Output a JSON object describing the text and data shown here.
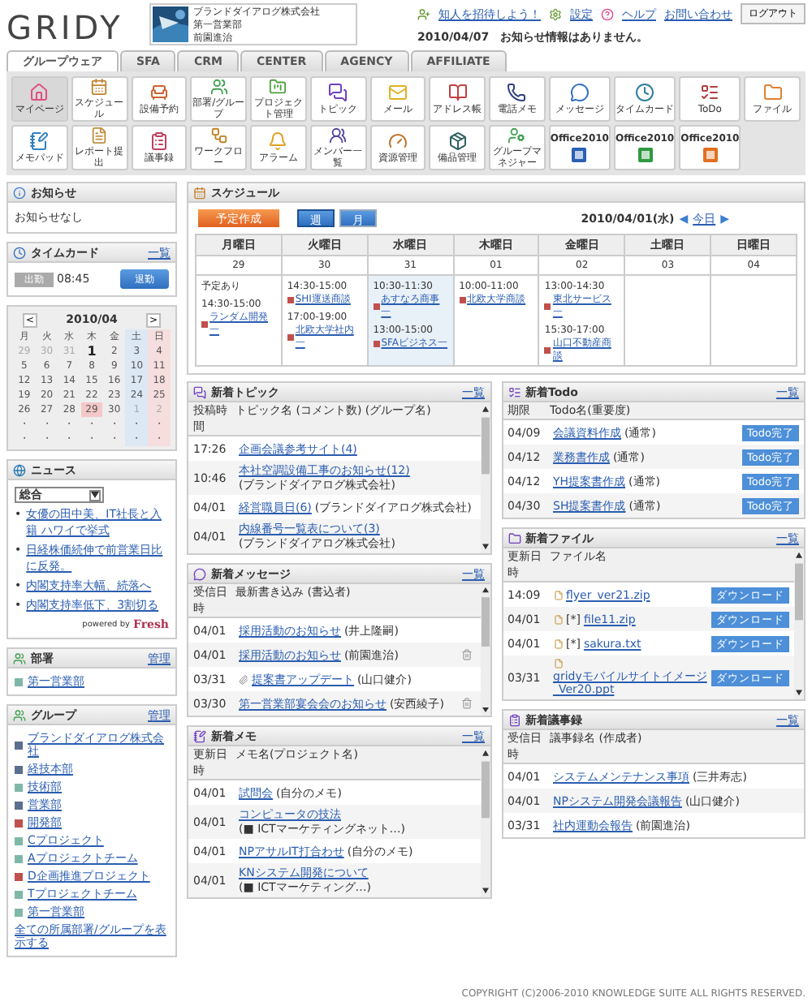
{
  "header": {
    "logo": "GRIDY",
    "company": [
      "ブランドダイアログ株式会社",
      "第一営業部",
      "前園進治"
    ],
    "links": [
      {
        "label": "知人を招待しよう！"
      },
      {
        "label": "設定"
      },
      {
        "label": "ヘルプ"
      },
      {
        "label": "お問い合わせ"
      }
    ],
    "logout": "ログアウト",
    "notice": "2010/04/07　お知らせ情報はありません。"
  },
  "tabs": [
    {
      "label": "グループウェア",
      "selected": true
    },
    {
      "label": "SFA",
      "selected": false
    },
    {
      "label": "CRM",
      "selected": false
    },
    {
      "label": "CENTER",
      "selected": false
    },
    {
      "label": "AGENCY",
      "selected": false
    },
    {
      "label": "AFFILIATE",
      "selected": false
    }
  ],
  "apps": [
    {
      "kind": "app",
      "label": "マイページ",
      "selected": true
    },
    {
      "kind": "app",
      "label": "スケジュール",
      "selected": false
    },
    {
      "kind": "app",
      "label": "設備予約",
      "selected": false
    },
    {
      "kind": "app",
      "label": "部署/グループ",
      "selected": false
    },
    {
      "kind": "app",
      "label": "プロジェクト管理",
      "selected": false
    },
    {
      "kind": "app",
      "label": "トピック",
      "selected": false
    },
    {
      "kind": "app",
      "label": "メール",
      "selected": false
    },
    {
      "kind": "app",
      "label": "アドレス帳",
      "selected": false
    },
    {
      "kind": "app",
      "label": "電話メモ",
      "selected": false
    },
    {
      "kind": "app",
      "label": "メッセージ",
      "selected": false
    },
    {
      "kind": "app",
      "label": "タイムカード",
      "selected": false
    },
    {
      "kind": "app",
      "label": "ToDo",
      "selected": false
    },
    {
      "kind": "app",
      "label": "ファイル",
      "selected": false
    },
    {
      "kind": "app",
      "label": "メモパッド",
      "selected": false
    },
    {
      "kind": "app",
      "label": "レポート提出",
      "selected": false
    },
    {
      "kind": "app",
      "label": "議事録",
      "selected": false
    },
    {
      "kind": "app",
      "label": "ワークフロー",
      "selected": false
    },
    {
      "kind": "app",
      "label": "アラーム",
      "selected": false
    },
    {
      "kind": "app",
      "label": "メンバー一覧",
      "selected": false
    },
    {
      "kind": "app",
      "label": "資源管理",
      "selected": false
    },
    {
      "kind": "app",
      "label": "備品管理",
      "selected": false
    },
    {
      "kind": "app",
      "label": "グループマネジャー",
      "selected": false
    },
    {
      "kind": "office",
      "label": "Office2010",
      "selected": false
    },
    {
      "kind": "office",
      "label": "Office2010",
      "selected": false
    },
    {
      "kind": "office",
      "label": "Office2010",
      "selected": false
    }
  ],
  "notice_box": {
    "title": "お知らせ",
    "text": "お知らせなし"
  },
  "timecard": {
    "title": "タイムカード",
    "link": "一覧",
    "clock_in": {
      "label": "出勤",
      "disabled": true
    },
    "time": "08:45",
    "clock_out": {
      "label": "退勤",
      "disabled": false
    }
  },
  "calendar": {
    "prev": "<",
    "month": "2010/04",
    "next": ">",
    "weekdays": [
      "月",
      "火",
      "水",
      "木",
      "金",
      "土",
      "日"
    ],
    "weeks": [
      [
        {
          "day": "29",
          "muted": true,
          "selected": false,
          "holiday": false
        },
        {
          "day": "30",
          "muted": true,
          "selected": false,
          "holiday": false
        },
        {
          "day": "31",
          "muted": true,
          "selected": false,
          "holiday": false
        },
        {
          "day": "1",
          "muted": false,
          "selected": true,
          "holiday": false
        },
        {
          "day": "2",
          "muted": false,
          "selected": false,
          "holiday": false
        },
        {
          "day": "3",
          "muted": false,
          "selected": false,
          "holiday": false
        },
        {
          "day": "4",
          "muted": false,
          "selected": false,
          "holiday": false
        }
      ],
      [
        {
          "day": "5",
          "muted": false,
          "selected": false,
          "holiday": false
        },
        {
          "day": "6",
          "muted": false,
          "selected": false,
          "holiday": false
        },
        {
          "day": "7",
          "muted": false,
          "selected": false,
          "holiday": false
        },
        {
          "day": "8",
          "muted": false,
          "selected": false,
          "holiday": false
        },
        {
          "day": "9",
          "muted": false,
          "selected": false,
          "holiday": false
        },
        {
          "day": "10",
          "muted": false,
          "selected": false,
          "holiday": false
        },
        {
          "day": "11",
          "muted": false,
          "selected": false,
          "holiday": false
        }
      ],
      [
        {
          "day": "12",
          "muted": false,
          "selected": false,
          "holiday": false
        },
        {
          "day": "13",
          "muted": false,
          "selected": false,
          "holiday": false
        },
        {
          "day": "14",
          "muted": false,
          "selected": false,
          "holiday": false
        },
        {
          "day": "15",
          "muted": false,
          "selected": false,
          "holiday": false
        },
        {
          "day": "16",
          "muted": false,
          "selected": false,
          "holiday": false
        },
        {
          "day": "17",
          "muted": false,
          "selected": false,
          "holiday": false
        },
        {
          "day": "18",
          "muted": false,
          "selected": false,
          "holiday": false
        }
      ],
      [
        {
          "day": "19",
          "muted": false,
          "selected": false,
          "holiday": false
        },
        {
          "day": "20",
          "muted": false,
          "selected": false,
          "holiday": false
        },
        {
          "day": "21",
          "muted": false,
          "selected": false,
          "holiday": false
        },
        {
          "day": "22",
          "muted": false,
          "selected": false,
          "holiday": false
        },
        {
          "day": "23",
          "muted": false,
          "selected": false,
          "holiday": false
        },
        {
          "day": "24",
          "muted": false,
          "selected": false,
          "holiday": false
        },
        {
          "day": "25",
          "muted": false,
          "selected": false,
          "holiday": false
        }
      ],
      [
        {
          "day": "26",
          "muted": false,
          "selected": false,
          "holiday": false
        },
        {
          "day": "27",
          "muted": false,
          "selected": false,
          "holiday": false
        },
        {
          "day": "28",
          "muted": false,
          "selected": false,
          "holiday": false
        },
        {
          "day": "29",
          "muted": false,
          "selected": false,
          "holiday": true
        },
        {
          "day": "30",
          "muted": false,
          "selected": false,
          "holiday": false
        },
        {
          "day": "1",
          "muted": true,
          "selected": false,
          "holiday": false
        },
        {
          "day": "2",
          "muted": true,
          "selected": false,
          "holiday": false
        }
      ],
      [
        {
          "day": "・",
          "muted": false,
          "selected": false,
          "holiday": false
        },
        {
          "day": "・",
          "muted": false,
          "selected": false,
          "holiday": false
        },
        {
          "day": "・",
          "muted": false,
          "selected": false,
          "holiday": false
        },
        {
          "day": "・",
          "muted": false,
          "selected": false,
          "holiday": false
        },
        {
          "day": "・",
          "muted": false,
          "selected": false,
          "holiday": false
        },
        {
          "day": "・",
          "muted": false,
          "selected": false,
          "holiday": false
        },
        {
          "day": "・",
          "muted": false,
          "selected": false,
          "holiday": false
        }
      ],
      [
        {
          "day": "・",
          "muted": false,
          "selected": false,
          "holiday": false
        },
        {
          "day": "・",
          "muted": false,
          "selected": false,
          "holiday": false
        },
        {
          "day": "・",
          "muted": false,
          "selected": false,
          "holiday": false
        },
        {
          "day": "・",
          "muted": false,
          "selected": false,
          "holiday": false
        },
        {
          "day": "・",
          "muted": false,
          "selected": false,
          "holiday": false
        },
        {
          "day": "・",
          "muted": false,
          "selected": false,
          "holiday": false
        },
        {
          "day": "・",
          "muted": false,
          "selected": false,
          "holiday": false
        }
      ]
    ]
  },
  "news": {
    "title": "ニュース",
    "category": "総合",
    "marker": "•",
    "items": [
      "女優の田中美、IT社長と入籍 ハワイで挙式",
      "日経株価続伸で前営業日比に反発。",
      "内閣支持率大幅、続落へ",
      "内閣支持率低下、3割切る"
    ],
    "powered_by": "powered by",
    "brand": "Fresh"
  },
  "departments": {
    "title": "部署",
    "link": "管理",
    "items": [
      {
        "label": "第一営業部",
        "color": "#7fb8a8"
      }
    ]
  },
  "groups": {
    "title": "グループ",
    "link": "管理",
    "items": [
      {
        "label": "ブランドダイアログ株式会社",
        "color": "#5b6f8e"
      },
      {
        "label": "経技本部",
        "color": "#5b6f8e"
      },
      {
        "label": "技術部",
        "color": "#7fb8a8"
      },
      {
        "label": "営業部",
        "color": "#5b6f8e"
      },
      {
        "label": "開発部",
        "color": "#c0504d"
      },
      {
        "label": "Cプロジェクト",
        "color": "#7fb8a8"
      },
      {
        "label": "Aプロジェクトチーム",
        "color": "#7fb8a8"
      },
      {
        "label": "D企画推進プロジェクト",
        "color": "#c0504d"
      },
      {
        "label": "Tプロジェクトチーム",
        "color": "#7fb8a8"
      },
      {
        "label": "第一営業部",
        "color": "#7fb8a8"
      }
    ],
    "show_all": "全ての所属部署/グループを表示する"
  },
  "schedule": {
    "title": "スケジュール",
    "create": "予定作成",
    "views": [
      {
        "label": "週",
        "selected": true
      },
      {
        "label": "月",
        "selected": false
      }
    ],
    "date": "2010/04/01(水)",
    "prev": "◀",
    "today": "今日",
    "next": "▶",
    "days": [
      {
        "name": "月曜日",
        "date": "29",
        "today": false,
        "entries": [
          {
            "kind": "note",
            "text": "予定あり"
          },
          {
            "kind": "event",
            "time": "14:30-15:00",
            "title": "ランダム開発一"
          }
        ]
      },
      {
        "name": "火曜日",
        "date": "30",
        "today": false,
        "entries": [
          {
            "kind": "event",
            "time": "14:30-15:00",
            "title": "SHI運送商談"
          },
          {
            "kind": "event",
            "time": "17:00-19:00",
            "title": "北欧大学社内一"
          }
        ]
      },
      {
        "name": "水曜日",
        "date": "31",
        "today": true,
        "entries": [
          {
            "kind": "event",
            "time": "10:30-11:30",
            "title": "あすなろ商事一"
          },
          {
            "kind": "event",
            "time": "13:00-15:00",
            "title": "SFAビジネス一"
          }
        ]
      },
      {
        "name": "木曜日",
        "date": "01",
        "today": false,
        "entries": [
          {
            "kind": "event",
            "time": "10:00-11:00",
            "title": "北欧大学商談"
          }
        ]
      },
      {
        "name": "金曜日",
        "date": "02",
        "today": false,
        "entries": [
          {
            "kind": "event",
            "time": "13:00-14:30",
            "title": "東北サービス一"
          },
          {
            "kind": "event",
            "time": "15:30-17:00",
            "title": "山口不動産商談"
          }
        ]
      },
      {
        "name": "土曜日",
        "date": "03",
        "today": false
      },
      {
        "name": "日曜日",
        "date": "04",
        "today": false
      }
    ]
  },
  "topics": {
    "title": "新着トピック",
    "link": "一覧",
    "scrollbar": true,
    "columns": [
      "投稿時間",
      "トピック名 (コメント数) (グループ名)"
    ],
    "rows": [
      {
        "date": "17:26",
        "link": "企画会議参考サイト(4)"
      },
      {
        "date": "10:46",
        "link": "本社空調設備工事のお知らせ(12)",
        "note": "(ブランドダイアログ株式会社)"
      },
      {
        "date": "04/01",
        "link": "経営職員日(6)",
        "note": "(ブランドダイアログ株式会社)"
      },
      {
        "date": "04/01",
        "link": "内線番号一覧表について(3)",
        "note": "(ブランドダイアログ株式会社)"
      }
    ]
  },
  "messages": {
    "title": "新着メッセージ",
    "link": "一覧",
    "scrollbar": true,
    "columns": [
      "受信日時",
      "最新書き込み (書込者)"
    ],
    "rows": [
      {
        "date": "04/01",
        "link": "採用活動のお知らせ",
        "note": "(井上隆嗣)",
        "attachment": false,
        "deletable": false
      },
      {
        "date": "04/01",
        "link": "採用活動のお知らせ",
        "note": "(前園進治)",
        "attachment": false,
        "deletable": true
      },
      {
        "date": "03/31",
        "link": "提案書アップデート",
        "note": "(山口健介)",
        "attachment": true,
        "deletable": false
      },
      {
        "date": "03/30",
        "link": "第一営業部宴会会のお知らせ",
        "note": "(安西綾子)",
        "attachment": false,
        "deletable": true
      }
    ]
  },
  "memos": {
    "title": "新着メモ",
    "link": "一覧",
    "scrollbar": true,
    "columns": [
      "更新日時",
      "メモ名(プロジェクト名)"
    ],
    "rows": [
      {
        "date": "04/01",
        "link": "試問会",
        "note": "(自分のメモ)"
      },
      {
        "date": "04/01",
        "link": "コンピュータの技法",
        "note": "(■ ICTマーケティングネット…)"
      },
      {
        "date": "04/01",
        "link": "NPアサルIT打合わせ",
        "note": "(自分のメモ)"
      },
      {
        "date": "04/01",
        "link": "KNシステム開発について",
        "note": "(■ ICTマーケティング…)"
      }
    ]
  },
  "todos": {
    "title": "新着Todo",
    "link": "一覧",
    "scrollbar": false,
    "columns": [
      "期限",
      "Todo名(重要度)"
    ],
    "rows": [
      {
        "date": "04/09",
        "link": "会議資料作成",
        "note": "(通常)",
        "button": "Todo完了"
      },
      {
        "date": "04/12",
        "link": "業務書作成",
        "note": "(通常)",
        "button": "Todo完了"
      },
      {
        "date": "04/12",
        "link": "YH提案書作成",
        "note": "(通常)",
        "button": "Todo完了"
      },
      {
        "date": "04/30",
        "link": "SH提案書作成",
        "note": "(通常)",
        "button": "Todo完了"
      }
    ]
  },
  "files": {
    "title": "新着ファイル",
    "link": "一覧",
    "scrollbar": true,
    "columns": [
      "更新日時",
      "ファイル名"
    ],
    "rows": [
      {
        "date": "14:09",
        "link": "flyer_ver21.zip",
        "button": "ダウンロード"
      },
      {
        "date": "04/01",
        "prefix": "[*]",
        "link": "file11.zip",
        "button": "ダウンロード"
      },
      {
        "date": "04/01",
        "prefix": "[*]",
        "link": "sakura.txt",
        "button": "ダウンロード"
      },
      {
        "date": "03/31",
        "link": "gridyモバイルサイトイメージ_Ver20.ppt",
        "button": "ダウンロード"
      }
    ]
  },
  "minutes": {
    "title": "新着議事録",
    "link": "一覧",
    "scrollbar": false,
    "columns": [
      "受信日時",
      "議事録名 (作成者)"
    ],
    "rows": [
      {
        "date": "04/01",
        "link": "システムメンテナンス事項",
        "note": "(三井寿志)"
      },
      {
        "date": "04/01",
        "link": "NPシステム開発会議報告",
        "note": "(山口健介)"
      },
      {
        "date": "03/31",
        "link": "社内運動会報告",
        "note": "(前園進治)"
      }
    ]
  },
  "footer": "COPYRIGHT (C)2006-2010 KNOWLEDGE SUITE ALL RIGHTS RESERVED."
}
